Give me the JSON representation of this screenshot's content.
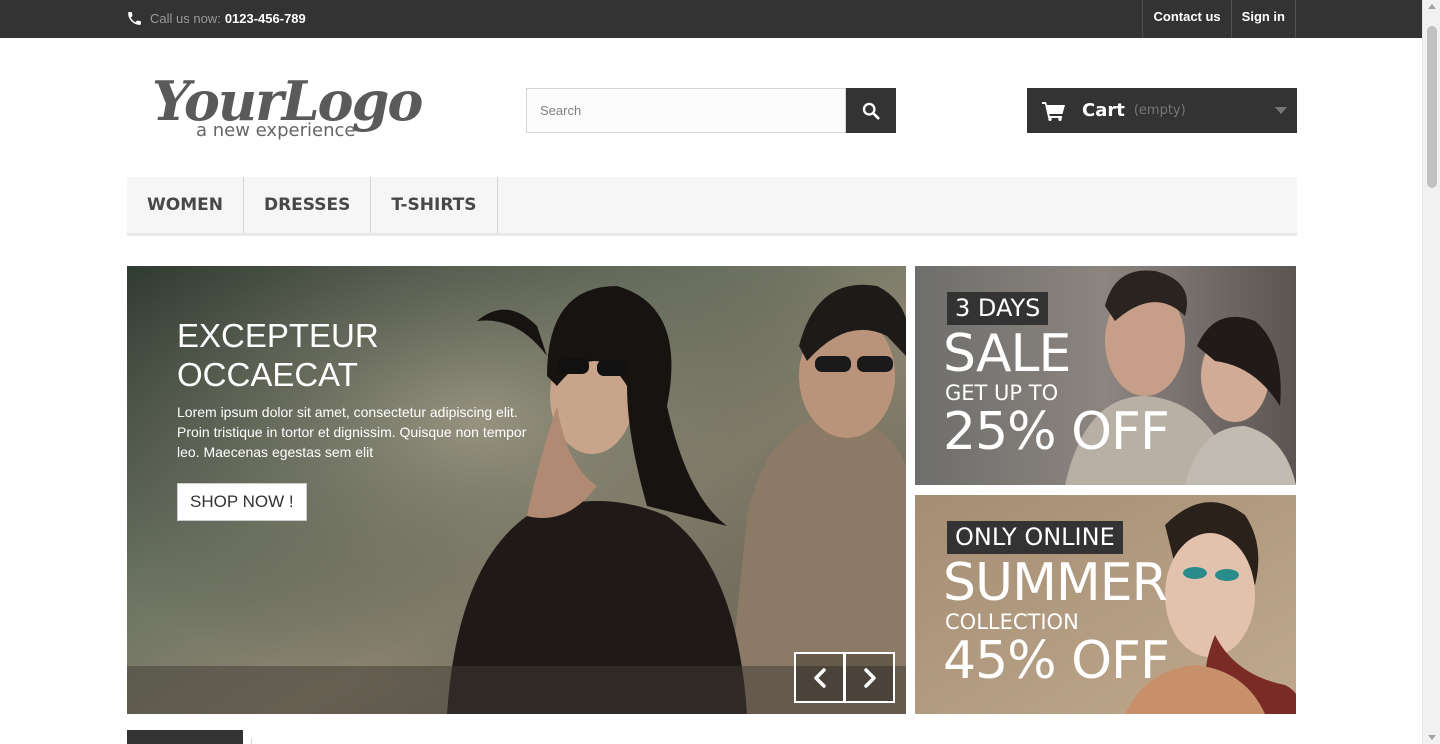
{
  "topbar": {
    "phone_label": "Call us now:",
    "phone_number": "0123-456-789",
    "links": [
      "Contact us",
      "Sign in"
    ]
  },
  "header": {
    "logo_text": "YourLogo",
    "logo_tagline": "a new experience",
    "search": {
      "placeholder": "Search",
      "value": ""
    },
    "cart": {
      "label": "Cart",
      "status": "(empty)"
    }
  },
  "menu": {
    "items": [
      "WOMEN",
      "DRESSES",
      "T-SHIRTS"
    ]
  },
  "slider": {
    "title": "EXCEPTEUR OCCAECAT",
    "text": "Lorem ipsum dolor sit amet, consectetur adipiscing elit. Proin tristique in tortor et dignissim. Quisque non tempor leo. Maecenas egestas sem elit",
    "button": "SHOP NOW !"
  },
  "banners": [
    {
      "tag": "3 DAYS",
      "headline": "SALE",
      "subline": "GET UP TO",
      "discount": "25% OFF"
    },
    {
      "tag": "ONLY ONLINE",
      "headline": "SUMMER",
      "subline": "COLLECTION",
      "discount": "45% OFF"
    }
  ],
  "icons": {
    "phone": "phone-icon",
    "search": "search-icon",
    "cart": "cart-icon",
    "prev": "chevron-left-icon",
    "next": "chevron-right-icon"
  },
  "colors": {
    "dark": "#333333",
    "menu_bg": "#f6f6f6",
    "white": "#ffffff"
  }
}
